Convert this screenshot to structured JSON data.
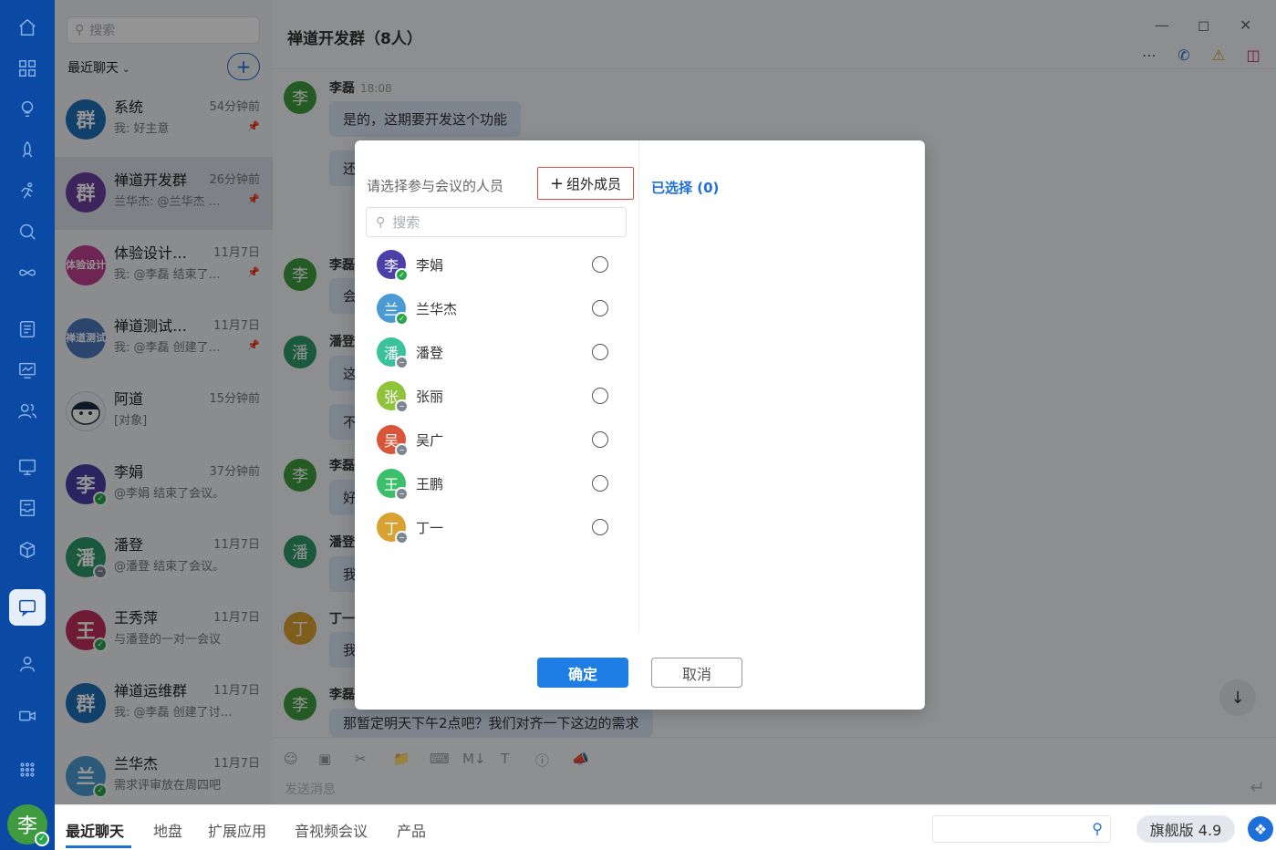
{
  "chatlist": {
    "search_placeholder": "搜索",
    "section_title": "最近聊天",
    "items": [
      {
        "name": "系统",
        "time": "54分钟前",
        "preview": "我: 好主意",
        "avatar": "群",
        "color": "#1e6fb8",
        "pinned": true
      },
      {
        "name": "禅道开发群",
        "time": "26分钟前",
        "preview": "兰华杰: @兰华杰 …",
        "avatar": "群",
        "color": "#6b3fa0",
        "pinned": true
      },
      {
        "name": "体验设计…",
        "time": "11月7日",
        "preview": "我: @李磊 结束了…",
        "avatar": "体验设计",
        "color": "#c0418f",
        "pinned": true
      },
      {
        "name": "禅道测试…",
        "time": "11月7日",
        "preview": "我: @李磊 创建了…",
        "avatar": "禅道测试",
        "color": "#4a78c0",
        "pinned": true
      },
      {
        "name": "阿道",
        "time": "15分钟前",
        "preview": "[对象]",
        "avatar": "",
        "color": "#e9eef5",
        "pinned": false
      },
      {
        "name": "李娟",
        "time": "37分钟前",
        "preview": "@李娟 结束了会议。",
        "avatar": "李",
        "color": "#4b3fa8",
        "status": "online"
      },
      {
        "name": "潘登",
        "time": "11月7日",
        "preview": "@潘登 结束了会议。",
        "avatar": "潘",
        "color": "#2f9a6a",
        "status": "offline"
      },
      {
        "name": "王秀萍",
        "time": "11月7日",
        "preview": "与潘登的一对一会议",
        "avatar": "王",
        "color": "#c2305d",
        "status": "online"
      },
      {
        "name": "禅道运维群",
        "time": "11月7日",
        "preview": "我: @李磊 创建了讨…",
        "avatar": "群",
        "color": "#1e6fb8"
      },
      {
        "name": "兰华杰",
        "time": "11月7日",
        "preview": "需求评审放在周四吧",
        "avatar": "兰",
        "color": "#4a9bd4",
        "status": "online"
      }
    ]
  },
  "main": {
    "title": "禅道开发群（8人）",
    "messages": [
      {
        "sender": "李磊",
        "time": "18:08",
        "text": "是的，这期要开发这个功能",
        "avatar": "李",
        "color": "#3f9b3f"
      },
      {
        "sender": "",
        "text": "还",
        "avatar": ""
      },
      {
        "sender": "李磊",
        "text": "会",
        "avatar": "李",
        "color": "#3f9b3f"
      },
      {
        "sender": "潘登",
        "text": "这",
        "avatar": "潘",
        "color": "#2f9a6a"
      },
      {
        "sender": "",
        "text": "不",
        "avatar": ""
      },
      {
        "sender": "李磊",
        "text": "好",
        "avatar": "李",
        "color": "#3f9b3f"
      },
      {
        "sender": "潘登",
        "text": "我",
        "avatar": "潘",
        "color": "#2f9a6a"
      },
      {
        "sender": "丁一",
        "text": "我",
        "avatar": "丁",
        "color": "#d9a032"
      },
      {
        "sender": "李磊",
        "text": "那暂定明天下午2点吧？我们对齐一下这边的需求",
        "avatar": "李",
        "color": "#3f9b3f"
      }
    ],
    "composer_placeholder": "发送消息"
  },
  "dialog": {
    "prompt_label": "请选择参与会议的人员",
    "external_button": "组外成员",
    "search_placeholder": "搜索",
    "selected_label": "已选择 (0)",
    "members": [
      {
        "name": "李娟",
        "avatar": "李",
        "color": "#4b3fa8",
        "status": "online"
      },
      {
        "name": "兰华杰",
        "avatar": "兰",
        "color": "#4a9bd4",
        "status": "online"
      },
      {
        "name": "潘登",
        "avatar": "潘",
        "color": "#3cc29a",
        "status": "offline"
      },
      {
        "name": "张丽",
        "avatar": "张",
        "color": "#8fc43a",
        "status": "offline"
      },
      {
        "name": "吴广",
        "avatar": "吴",
        "color": "#d9553a",
        "status": "offline"
      },
      {
        "name": "王鹏",
        "avatar": "王",
        "color": "#3cbf6a",
        "status": "offline"
      },
      {
        "name": "丁一",
        "avatar": "丁",
        "color": "#d9a032",
        "status": "offline"
      }
    ],
    "confirm_label": "确定",
    "cancel_label": "取消"
  },
  "bottombar": {
    "tabs": [
      "最近聊天",
      "地盘",
      "扩展应用",
      "音视频会议",
      "产品"
    ],
    "version": "旗舰版 4.9"
  },
  "user": {
    "avatar": "李",
    "color": "#3f9b3f"
  }
}
